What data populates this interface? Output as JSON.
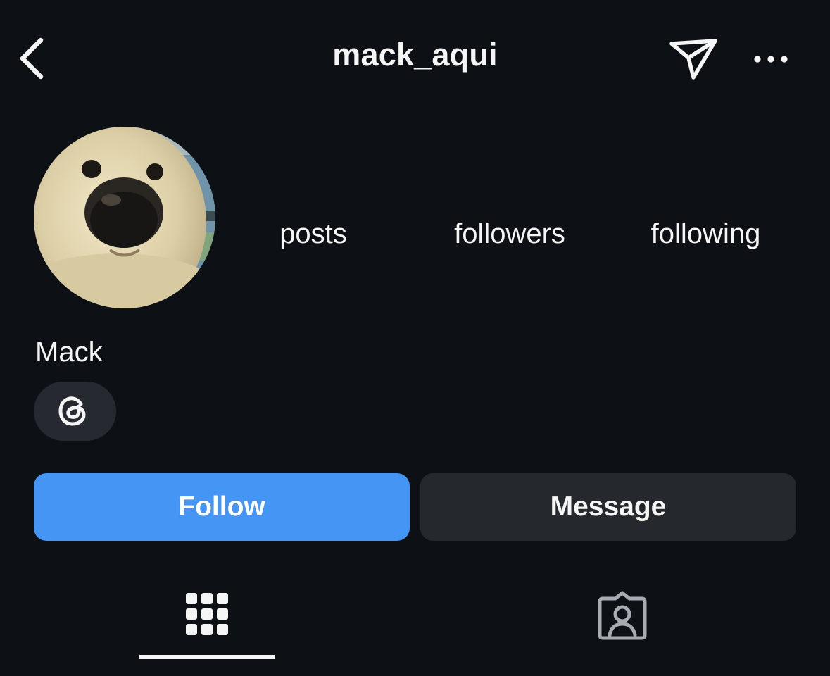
{
  "header": {
    "title": "mack_aqui",
    "back_icon": "chevron-left-icon",
    "send_icon": "paper-plane-icon",
    "more_icon": "more-horizontal-icon"
  },
  "profile": {
    "avatar": "avatar",
    "display_name": "Mack",
    "stats": {
      "posts_label": "posts",
      "followers_label": "followers",
      "following_label": "following"
    },
    "threads_icon": "threads-icon"
  },
  "actions": {
    "follow_label": "Follow",
    "message_label": "Message"
  },
  "tabs": {
    "grid_icon": "grid-icon",
    "tagged_icon": "tagged-icon"
  },
  "colors": {
    "background": "#0d1014",
    "follow_button": "#4495f4",
    "message_button": "#25282d",
    "chip": "#262a30",
    "text": "#f5f5f5"
  }
}
